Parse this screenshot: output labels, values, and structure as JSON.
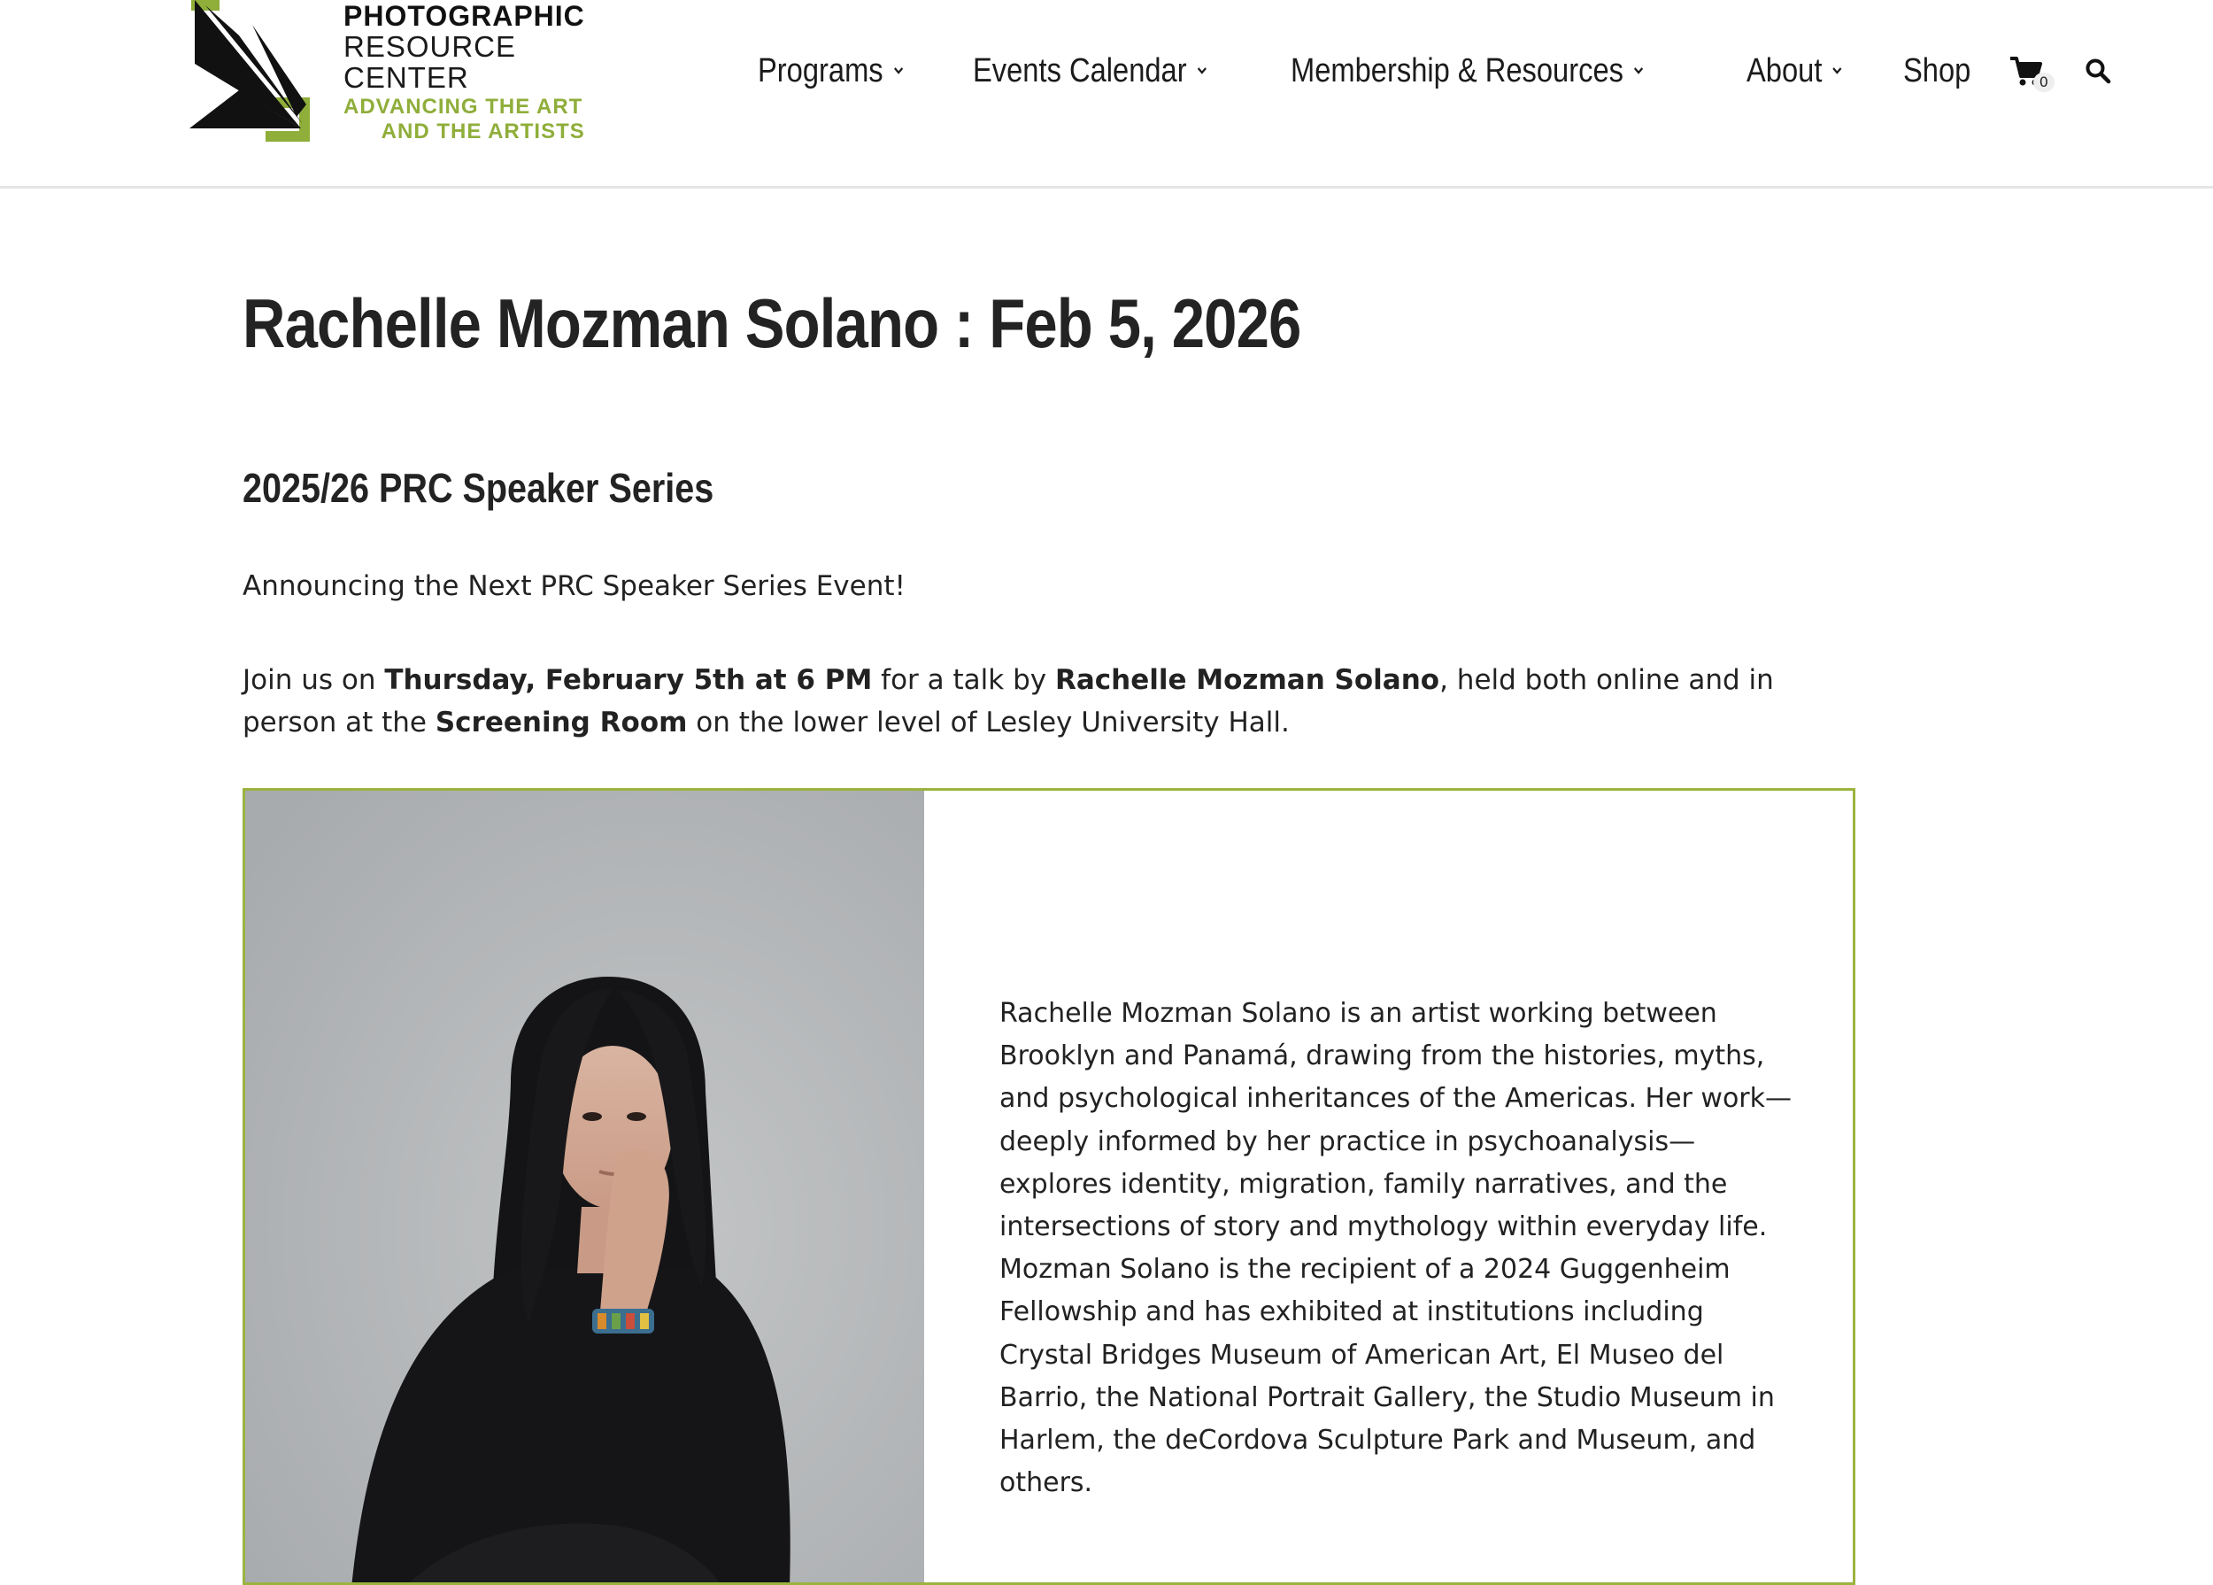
{
  "logo": {
    "line1": "PHOTOGRAPHIC",
    "line2": "RESOURCE",
    "line3": "CENTER",
    "line4": "ADVANCING THE ART",
    "line5": "AND THE ARTISTS",
    "brand_green": "#8fae3a"
  },
  "nav": {
    "items": [
      {
        "label": "Programs",
        "has_dropdown": true
      },
      {
        "label": "Events Calendar",
        "has_dropdown": true
      },
      {
        "label": "Membership & Resources",
        "has_dropdown": true
      },
      {
        "label": "About",
        "has_dropdown": true
      },
      {
        "label": "Shop",
        "has_dropdown": false
      }
    ],
    "cart_count": "0",
    "cart_icon": "cart-icon",
    "search_icon": "search-icon"
  },
  "page": {
    "title": "Rachelle Mozman Solano : Feb 5, 2026",
    "subtitle": "2025/26 PRC Speaker Series",
    "announcement": "Announcing the Next PRC Speaker Series Event!",
    "join": {
      "t1": "Join us on ",
      "b1": "Thursday, February 5th at 6 PM",
      "t2": " for a talk by ",
      "b2": "Rachelle Mozman Solano",
      "t3": ", held both online and in person at the ",
      "b3": "Screening Room",
      "t4": " on the lower level of Lesley University Hall."
    },
    "bio": "Rachelle Mozman Solano is an artist working between Brooklyn and Panamá, drawing from the histories, myths, and psychological inheritances of the Americas. Her work—deeply informed by her practice in psychoanalysis—explores identity, migration, family narratives, and the intersections of story and mythology within everyday life. Mozman Solano is the recipient of a 2024 Guggenheim Fellowship and has exhibited at institutions including Crystal Bridges Museum of American Art, El Museo del Barrio, the National Portrait Gallery, the Studio Museum in Harlem, the deCordova Sculpture Park and Museum, and others.",
    "card_border_color": "#9bb33f"
  }
}
